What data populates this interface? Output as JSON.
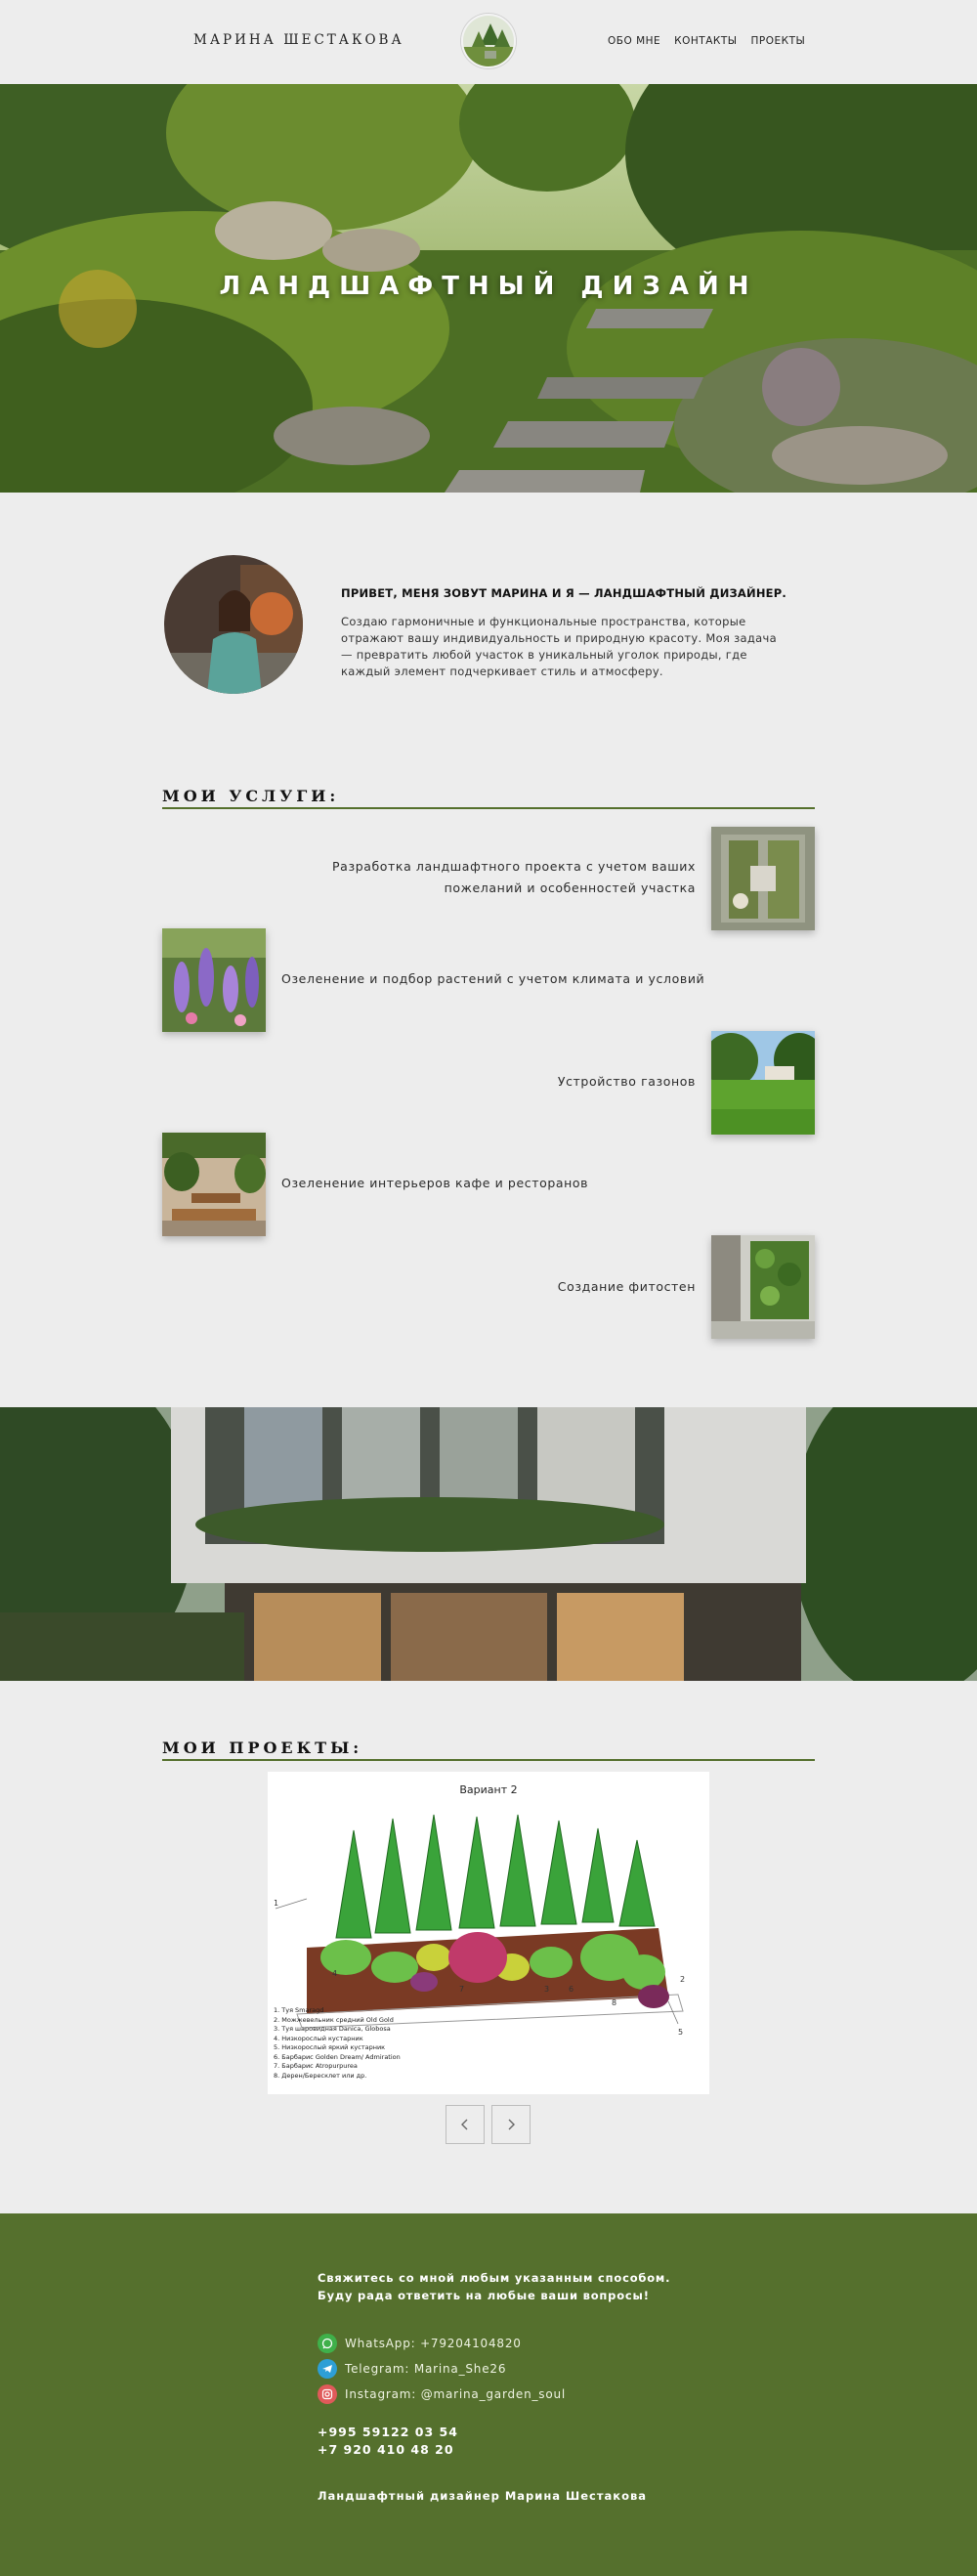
{
  "header": {
    "brand": "МАРИНА ШЕСТАКОВА",
    "nav": [
      "ОБО МНЕ",
      "КОНТАКТЫ",
      "ПРОЕКТЫ"
    ]
  },
  "hero": {
    "title": "ЛАНДШАФТНЫЙ ДИЗАЙН"
  },
  "about": {
    "heading": "ПРИВЕТ, МЕНЯ ЗОВУТ МАРИНА И Я — ЛАНДШАФТНЫЙ ДИЗАЙНЕР.",
    "text": "Создаю гармоничные и функциональные пространства, которые отражают вашу индивидуальность и природную красоту. Моя задача — превратить любой участок в уникальный уголок природы, где каждый элемент подчеркивает стиль и атмосферу."
  },
  "services": {
    "title": "МОИ УСЛУГИ:",
    "items": [
      "Разработка ландшафтного проекта с учетом ваших пожеланий и особенностей участка",
      "Озеленение и подбор растений с учетом климата и условий",
      "Устройство газонов",
      "Озеленение интерьеров кафе и ресторанов",
      "Создание фитостен"
    ]
  },
  "projects": {
    "title": "МОИ ПРОЕКТЫ:",
    "caption": "Вариант 2",
    "legend": [
      "1. Туя Smaragd",
      "2. Можжевельник средний Old Gold",
      "3. Туя шаровидная Danica, Globosa",
      "4. Низкорослый кустарник",
      "5. Низкорослый яркий кустарник",
      "6. Барбарис Golden Dream/ Admiration",
      "7. Барбарис Atropurpurea",
      "8. Дерен/Бересклет или др."
    ],
    "numbers": [
      "1",
      "2",
      "3",
      "4",
      "5",
      "6",
      "7",
      "8"
    ]
  },
  "footer": {
    "intro_line1": "Свяжитесь со мной любым указанным способом.",
    "intro_line2": "Буду рада ответить на любые ваши вопросы!",
    "whatsapp": "WhatsApp: +79204104820",
    "telegram": "Telegram: Marina_She26",
    "instagram": "Instagram: @marina_garden_soul",
    "phone1": "+995 59122 03 54",
    "phone2": "+7 920 410 48 20",
    "signature": "Ландшафтный дизайнер Марина Шестакова"
  },
  "colors": {
    "accent": "#55702d",
    "background": "#ededed",
    "whatsapp": "#3fb04a",
    "telegram": "#2e9fd6",
    "instagram": "#e05a5a"
  }
}
